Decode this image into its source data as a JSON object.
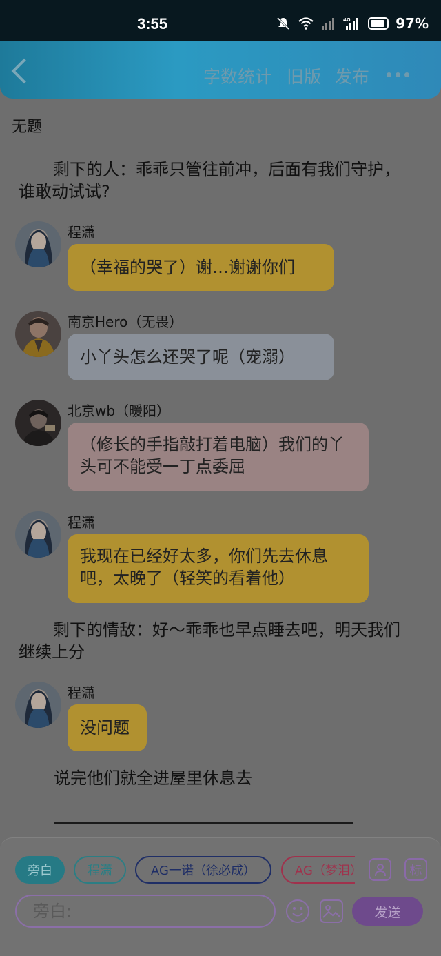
{
  "status_bar": {
    "time": "3:55",
    "battery": "97%",
    "network": "4G"
  },
  "header": {
    "actions": [
      "字数统计",
      "旧版",
      "发布"
    ]
  },
  "story": {
    "title": "无题",
    "narration_1": "剩下的人：乖乖只管往前冲，后面有我们守护，谁敢动试试?",
    "narration_2": "剩下的情敌：好～乖乖也早点睡去吧，明天我们继续上分",
    "narration_3": "说完他们就全进屋里休息去"
  },
  "messages": [
    {
      "name": "程潇",
      "text": "（幸福的哭了）谢…谢谢你们",
      "color": "#b19130"
    },
    {
      "name": "南京Hero（无畏）",
      "text": "小丫头怎么还哭了呢（宠溺）",
      "color": "#8a9099"
    },
    {
      "name": "北京wb（暖阳）",
      "text": "（修长的手指敲打着电脑）我们的丫头可不能受一丁点委屈",
      "color": "#9a8383"
    },
    {
      "name": "程潇",
      "text": "我现在已经好太多，你们先去休息吧，太晚了（轻笑的看着他）",
      "color": "#b19130"
    },
    {
      "name": "程潇",
      "text": "没问题",
      "color": "#b19130"
    }
  ],
  "composer": {
    "chips": [
      "旁白",
      "程潇",
      "AG一诺（徐必成）",
      "AG（梦泪）"
    ],
    "input_placeholder": "旁白:",
    "tag_icon": "标",
    "send_label": "发送"
  }
}
